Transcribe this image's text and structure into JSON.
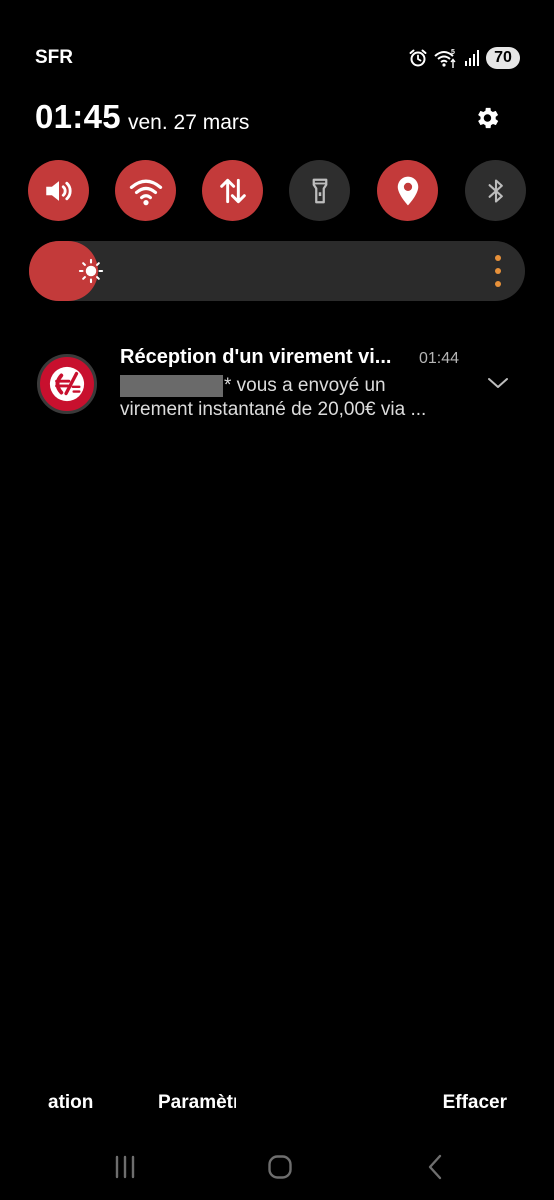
{
  "status_bar": {
    "carrier": "SFR",
    "battery": "70",
    "icons": [
      "alarm-icon",
      "wifi-5g-icon",
      "signal-icon",
      "battery-icon"
    ]
  },
  "header": {
    "time": "01:45",
    "date": "ven. 27 mars",
    "settings_icon": "gear-icon"
  },
  "quick_toggles": [
    {
      "name": "sound",
      "icon": "volume-icon",
      "state": "on"
    },
    {
      "name": "wifi",
      "icon": "wifi-icon",
      "state": "on"
    },
    {
      "name": "mobile-data",
      "icon": "data-arrows-icon",
      "state": "on"
    },
    {
      "name": "flashlight",
      "icon": "flashlight-icon",
      "state": "off"
    },
    {
      "name": "location",
      "icon": "location-pin-icon",
      "state": "on"
    },
    {
      "name": "bluetooth",
      "icon": "bluetooth-icon",
      "state": "off"
    }
  ],
  "brightness": {
    "level": 0.14,
    "icon": "sun-icon"
  },
  "notification": {
    "app_icon": "caisse-epargne-icon",
    "title": "Réception d'un virement vi...",
    "time": "01:44",
    "line1_suffix": "* vous a envoyé un",
    "line2": "virement instantané de  20,00€ via ..."
  },
  "bottom_actions": {
    "notif_settings": "ation",
    "settings": "Paramètres",
    "clear": "Effacer"
  },
  "navigation": {
    "recents": "recents-icon",
    "home": "home-icon",
    "back": "back-icon"
  },
  "colors": {
    "accent": "#c33a3a",
    "toggle_off": "#2e2e2e",
    "background": "#000000",
    "menu_dots": "#e8913a"
  }
}
